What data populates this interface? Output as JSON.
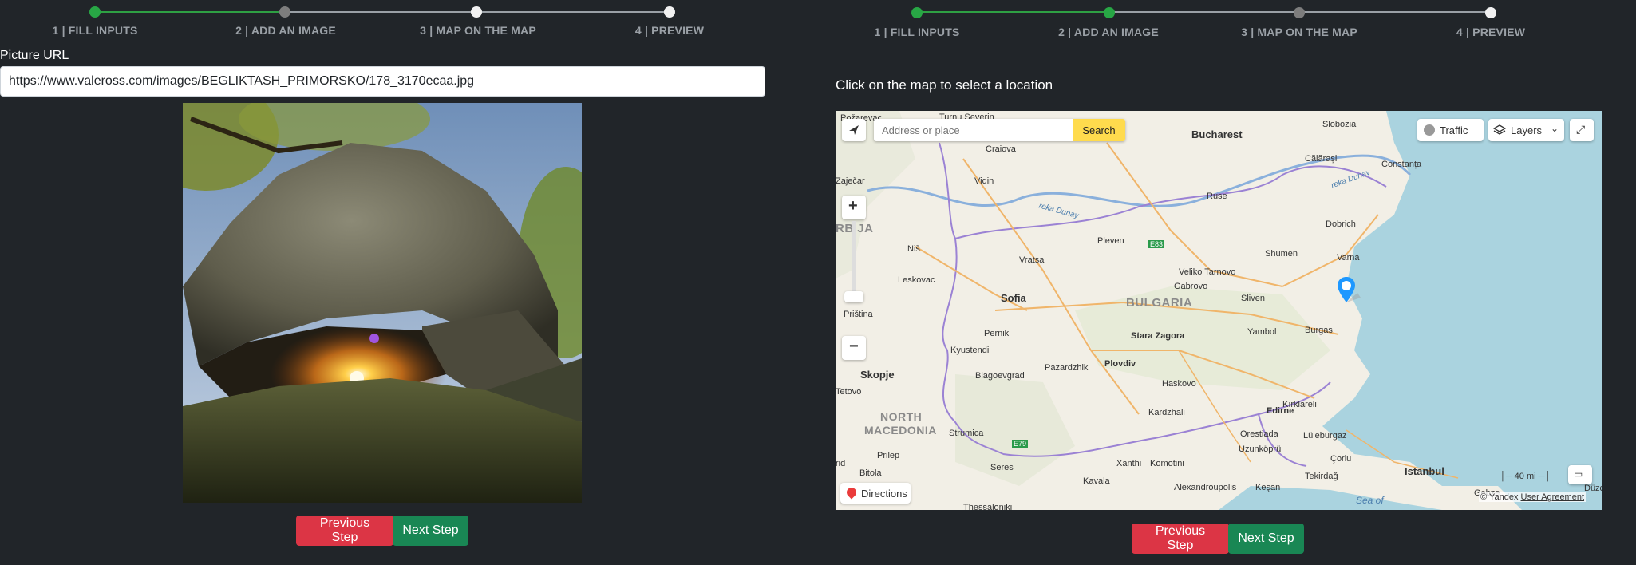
{
  "left": {
    "steps": [
      "1 | FILL INPUTS",
      "2 | ADD AN IMAGE",
      "3 | MAP ON THE MAP",
      "4 | PREVIEW"
    ],
    "step_states": [
      "done",
      "current",
      "next",
      "todo"
    ],
    "url_label": "Picture URL",
    "url_value": "https://www.valeross.com/images/BEGLIKTASH_PRIMORSKO/178_3170ecaa.jpg",
    "prev_label": "Previous Step",
    "next_label": "Next Step"
  },
  "right": {
    "steps": [
      "1 | FILL INPUTS",
      "2 | ADD AN IMAGE",
      "3 | MAP ON THE MAP",
      "4 | PREVIEW"
    ],
    "step_states": [
      "done",
      "done",
      "current",
      "todo"
    ],
    "hint": "Click on the map to select a location",
    "prev_label": "Previous Step",
    "next_label": "Next Step",
    "map": {
      "search_placeholder": "Address or place",
      "search_button": "Search",
      "traffic": "Traffic",
      "layers": "Layers",
      "directions": "Directions",
      "scale": "40 mi",
      "copyright": "© Yandex",
      "agreement": "User Agreement",
      "places": {
        "bucharest": "Bucharest",
        "slobozia": "Slobozia",
        "turnu": "Turnu Severin",
        "pozarevac": "Požarevac",
        "craiova": "Craiova",
        "calarasi": "Călărași",
        "constanta": "Constanța",
        "vidin": "Vidin",
        "rekadunav": "reka Dunav",
        "rekadunay": "reka Dunay",
        "rusa": "Ruse",
        "dobrich": "Dobrich",
        "zajecar": "Zaječar",
        "srbija": "RBIJA",
        "nis": "Niš",
        "pleven": "Pleven",
        "e83": "E83",
        "shumen": "Shumen",
        "varna": "Varna",
        "vratsa": "Vratsa",
        "veliko": "Veliko Tarnovo",
        "leskovac": "Leskovac",
        "gabrovo": "Gabrovo",
        "sofia": "Sofia",
        "bulgaria": "BULGARIA",
        "sliven": "Sliven",
        "pristina": "Priština",
        "burgas": "Burgas",
        "pernik": "Pernik",
        "stara": "Stara Zagora",
        "yambol": "Yambol",
        "kyustendil": "Kyustendil",
        "skopje": "Skopje",
        "pazardzhik": "Pazardzhik",
        "plovdiv": "Plovdiv",
        "blagoevgrad": "Blagoevgrad",
        "tetovo": "Tetovo",
        "haskovo": "Haskovo",
        "kirklareli": "Kırklareli",
        "edirne": "Edirne",
        "north": "NORTH",
        "macedonia": "MACEDONIA",
        "kardzhali": "Kardzhali",
        "strumica": "Strumica",
        "e79": "E79",
        "orestiada": "Orestiada",
        "luleburgaz": "Lüleburgaz",
        "uzunkopru": "Uzunköprü",
        "prilep": "Prilep",
        "corlu": "Çorlu",
        "xanthi": "Xanthi",
        "komotini": "Komotini",
        "seres": "Seres",
        "bitola": "Bitola",
        "istanbul": "Istanbul",
        "tekirdag": "Tekirdağ",
        "kavala": "Kavala",
        "alexandroupolis": "Alexandroupolis",
        "kesan": "Keşan",
        "gebze": "Gebze",
        "duzce": "Düzce",
        "seaof": "Sea of",
        "thessaloniki": "Thessaloniki",
        "ohrid": "rid"
      }
    }
  }
}
